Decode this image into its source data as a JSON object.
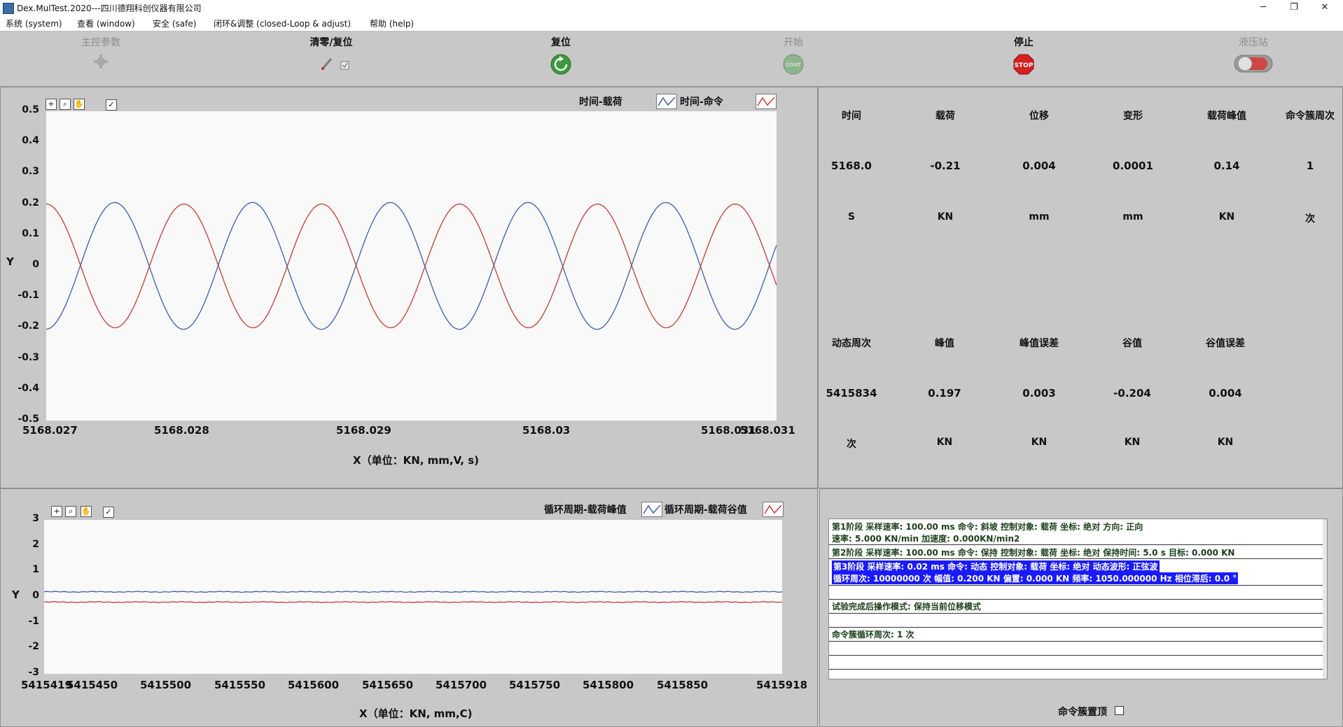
{
  "window": {
    "title": "Dex.MulTest.2020---四川德翔科创仪器有限公司",
    "min": "─",
    "restore": "❐",
    "close": "✕"
  },
  "menu": [
    "系统 (system)",
    "查看 (window)",
    "安全 (safe)",
    "闭环&调整 (closed-Loop & adjust)",
    "帮助 (help)"
  ],
  "toolbar": {
    "main_params": "主控参数",
    "zero_reset": "清零/复位",
    "reset": "复位",
    "start": "开始",
    "stop": "停止",
    "stop_icon_text": "STOP",
    "start_icon_text": "START",
    "hydraulic": "液压站"
  },
  "chart1": {
    "legend": [
      "时间-载荷",
      "时间-命令"
    ],
    "yticks": [
      "0.5",
      "0.4",
      "0.3",
      "0.2",
      "0.1",
      "0",
      "-0.1",
      "-0.2",
      "-0.3",
      "-0.4",
      "-0.5"
    ],
    "xticks": [
      "5168.027",
      "5168.028",
      "5168.029",
      "5168.03",
      "5168.031",
      "5168.031"
    ],
    "ylabel": "Y",
    "xlabel": "X（单位：KN, mm,V, s)"
  },
  "chart2": {
    "legend": [
      "循环周期-载荷峰值",
      "循环周期-载荷谷值"
    ],
    "yticks": [
      "3",
      "2",
      "1",
      "0",
      "-1",
      "-2",
      "-3"
    ],
    "xticks": [
      "5415419",
      "5415450",
      "5415500",
      "5415550",
      "5415600",
      "5415650",
      "5415700",
      "5415750",
      "5415800",
      "5415850",
      "5415918"
    ],
    "ylabel": "Y",
    "xlabel": "X（单位：KN, mm,C)"
  },
  "chart_data": [
    {
      "type": "line",
      "x_range": [
        5168.027,
        5168.031
      ],
      "ylim": [
        -0.5,
        0.5
      ],
      "series": [
        {
          "name": "时间-载荷",
          "color": "#3b5ea8",
          "amplitude": 0.205,
          "cycles": 5.3,
          "phase_deg": 180
        },
        {
          "name": "时间-命令",
          "color": "#c43a3a",
          "amplitude": 0.2,
          "cycles": 5.3,
          "phase_deg": 0
        }
      ]
    },
    {
      "type": "line",
      "x_range": [
        5415419,
        5415918
      ],
      "ylim": [
        -3,
        3
      ],
      "series": [
        {
          "name": "循环周期-载荷峰值",
          "color": "#3b5ea8",
          "value": 0.197
        },
        {
          "name": "循环周期-载荷谷值",
          "color": "#c43a3a",
          "value": -0.204
        }
      ]
    }
  ],
  "readout1": {
    "headers": [
      "时间",
      "载荷",
      "位移",
      "变形",
      "载荷峰值",
      "命令簇周次"
    ],
    "values": [
      "5168.0",
      "-0.21",
      "0.004",
      "0.0001",
      "0.14",
      "1"
    ],
    "units": [
      "S",
      "KN",
      "mm",
      "mm",
      "KN",
      "次"
    ]
  },
  "readout2": {
    "headers": [
      "动态周次",
      "峰值",
      "峰值误差",
      "谷值",
      "谷值误差"
    ],
    "values": [
      "5415834",
      "0.197",
      "0.003",
      "-0.204",
      "0.004"
    ],
    "units": [
      "次",
      "KN",
      "KN",
      "KN",
      "KN"
    ]
  },
  "info": {
    "row1a": "第1阶段  采样速率: 100.00  ms  命令: 斜坡  控制对象: 载荷  坐标: 绝对  方向: 正向",
    "row1b": "速率: 5.000  KN/min  加速度: 0.000KN/min2",
    "row2": "第2阶段  采样速率: 100.00  ms  命令: 保持  控制对象: 载荷  坐标: 绝对  保持时间: 5.0  s  目标: 0.000  KN",
    "row3a": "第3阶段  采样速率: 0.02  ms  命令: 动态  控制对象: 载荷  坐标: 绝对  动态波形: 正弦波",
    "row3b": "循环周次: 10000000  次  幅值: 0.200  KN  偏置: 0.000  KN  频率: 1050.000000  Hz  相位滞后: 0.0  °",
    "row4": "试验完成后操作模式: 保持当前位移模式",
    "row5": "命令簇循环周次: 1  次"
  },
  "pin_top": {
    "label": "命令簇置顶",
    "checked": false
  }
}
